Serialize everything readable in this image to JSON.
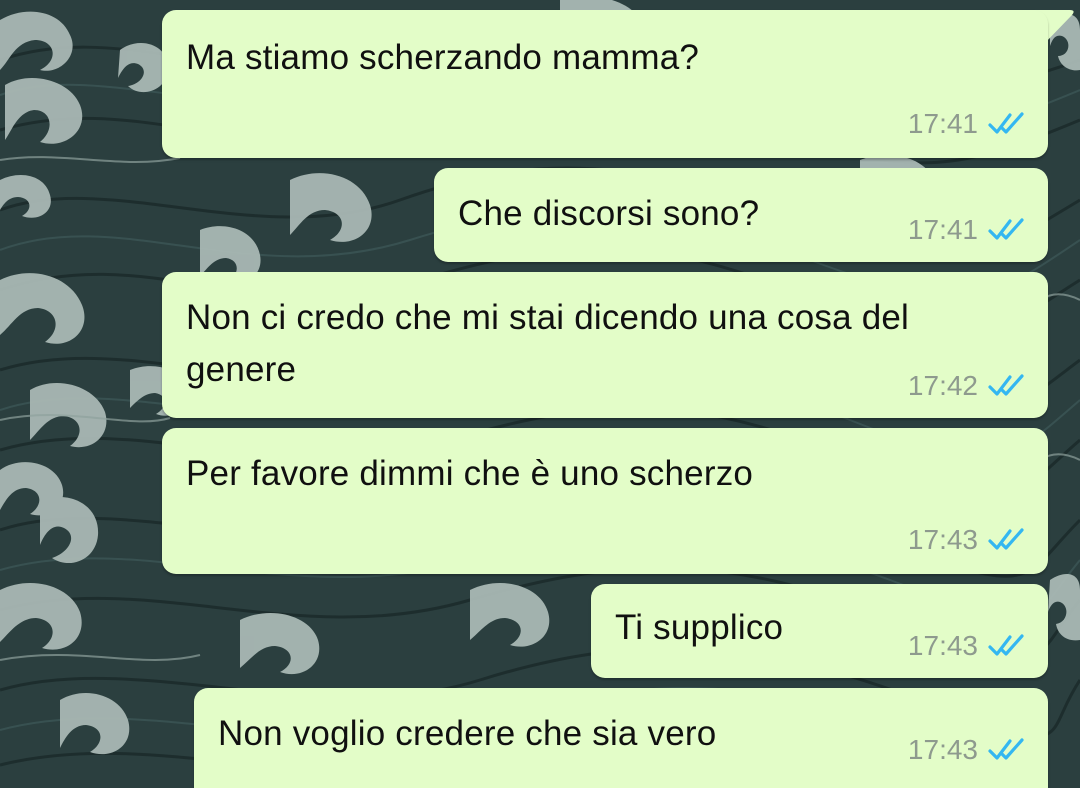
{
  "chat": {
    "colors": {
      "bubble_background": "#e3fdc8",
      "wallpaper_background": "#2b3f3f",
      "wave_light": "#a9b8b4",
      "timestamp": "#8e9a8e",
      "read_tick": "#34b7f1"
    },
    "status_icon": "double-check-read-icon",
    "messages": [
      {
        "text": "Ma stiamo scherzando mamma?",
        "time": "17:41",
        "status": "read"
      },
      {
        "text": "Che discorsi sono?",
        "time": "17:41",
        "status": "read"
      },
      {
        "text": "Non ci credo che mi stai dicendo una cosa del genere",
        "time": "17:42",
        "status": "read"
      },
      {
        "text": "Per favore dimmi che è uno scherzo",
        "time": "17:43",
        "status": "read"
      },
      {
        "text": "Ti supplico",
        "time": "17:43",
        "status": "read"
      },
      {
        "text": "Non voglio credere che sia vero",
        "time": "17:43",
        "status": "read"
      }
    ]
  }
}
